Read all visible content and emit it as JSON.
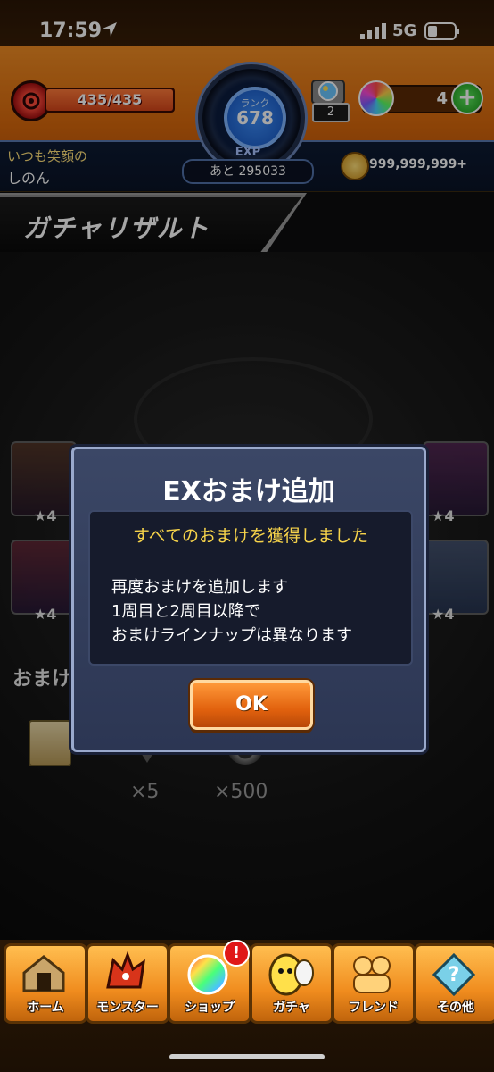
{
  "status_bar": {
    "time": "17:59",
    "network": "5G"
  },
  "hud": {
    "stamina": "435/435",
    "stamina_fraction": 1.0,
    "rank_label": "ランク",
    "rank_value": "678",
    "exp_label": "EXP",
    "exp_remaining": "あと 295033",
    "ticket_count": "2",
    "orb_count": "4",
    "orb_add": "+",
    "user_comment": "いつも笑顔の",
    "user_name": "しのん",
    "coins": "999,999,999+"
  },
  "page": {
    "title": "ガチャリザルト"
  },
  "background": {
    "card_stars": [
      "★4",
      "★4",
      "★4",
      "★4"
    ],
    "bonus_label": "おまけ",
    "quantities": [
      "×5",
      "×500"
    ]
  },
  "dialog": {
    "title": "EXおまけ追加",
    "highlight": "すべてのおまけを獲得しました",
    "lines": [
      "再度おまけを追加します",
      "1周目と2周目以降で",
      "おまけラインナップは異なります"
    ],
    "ok_label": "OK"
  },
  "nav": {
    "items": [
      {
        "label": "ホーム",
        "icon": "home-icon"
      },
      {
        "label": "モンスター",
        "icon": "monster-icon"
      },
      {
        "label": "ショップ",
        "icon": "shop-orb-icon"
      },
      {
        "label": "ガチャ",
        "icon": "gacha-egg-icon"
      },
      {
        "label": "フレンド",
        "icon": "friend-icon"
      },
      {
        "label": "その他",
        "icon": "other-icon"
      }
    ],
    "shop_badge": "!"
  },
  "colors": {
    "hud_orange": "#f08c24",
    "dialog_bg": "#2c3653",
    "highlight_yellow": "#f6d34a",
    "ok_orange": "#e2620e"
  }
}
